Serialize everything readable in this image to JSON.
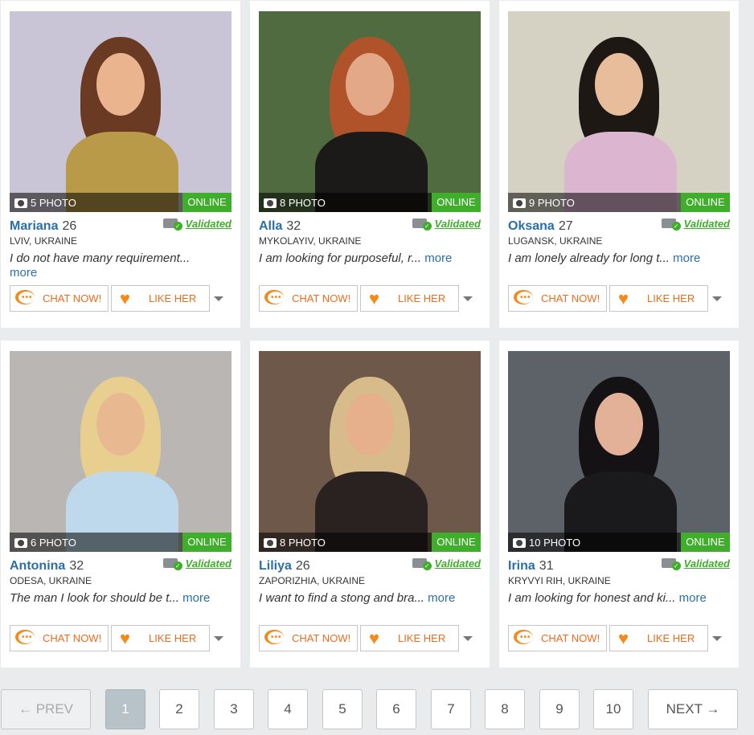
{
  "labels": {
    "online": "ONLINE",
    "validated": "Validated",
    "chat": "CHAT NOW!",
    "like": "LIKE HER",
    "more": "more"
  },
  "profiles": [
    {
      "name": "Mariana",
      "age": "26",
      "location": "LVIV, UKRAINE",
      "photos": "5 PHOTO",
      "desc": "I do not have many requirement...",
      "bg": "#c9c4d6",
      "hair": "#6b3a22",
      "skin": "#e9b48e",
      "outfit": "#b89a48"
    },
    {
      "name": "Alla",
      "age": "32",
      "location": "MYKOLAYIV, UKRAINE",
      "photos": "8 PHOTO",
      "desc": "I am looking for purposeful, r...",
      "bg": "#4f6b3f",
      "hair": "#b0532a",
      "skin": "#e3a887",
      "outfit": "#1c1a18"
    },
    {
      "name": "Oksana",
      "age": "27",
      "location": "LUGANSK, UKRAINE",
      "photos": "9 PHOTO",
      "desc": "I am lonely already for long t...",
      "bg": "#d6d2c3",
      "hair": "#1e1814",
      "skin": "#e8bd9c",
      "outfit": "#dcb6d0"
    },
    {
      "name": "Antonina",
      "age": "32",
      "location": "ODESA, UKRAINE",
      "photos": "6 PHOTO",
      "desc": "The man I look for should be t...",
      "bg": "#b9b6b3",
      "hair": "#e8cf90",
      "skin": "#e8b990",
      "outfit": "#bfd9ec"
    },
    {
      "name": "Liliya",
      "age": "26",
      "location": "ZAPORIZHIA, UKRAINE",
      "photos": "8 PHOTO",
      "desc": "I want to find a stong and bra...",
      "bg": "#6d5849",
      "hair": "#d8bb8a",
      "skin": "#e6b08c",
      "outfit": "#2a2220"
    },
    {
      "name": "Irina",
      "age": "31",
      "location": "KRYVYI RIH, UKRAINE",
      "photos": "10 PHOTO",
      "desc": "I am looking for honest and ki...",
      "bg": "#5d6268",
      "hair": "#141214",
      "skin": "#e2b197",
      "outfit": "#1a1a1c"
    }
  ],
  "pagination": {
    "prev": "← PREV",
    "next": "NEXT →",
    "pages": [
      "1",
      "2",
      "3",
      "4",
      "5",
      "6",
      "7",
      "8",
      "9",
      "10"
    ],
    "current": "1"
  }
}
